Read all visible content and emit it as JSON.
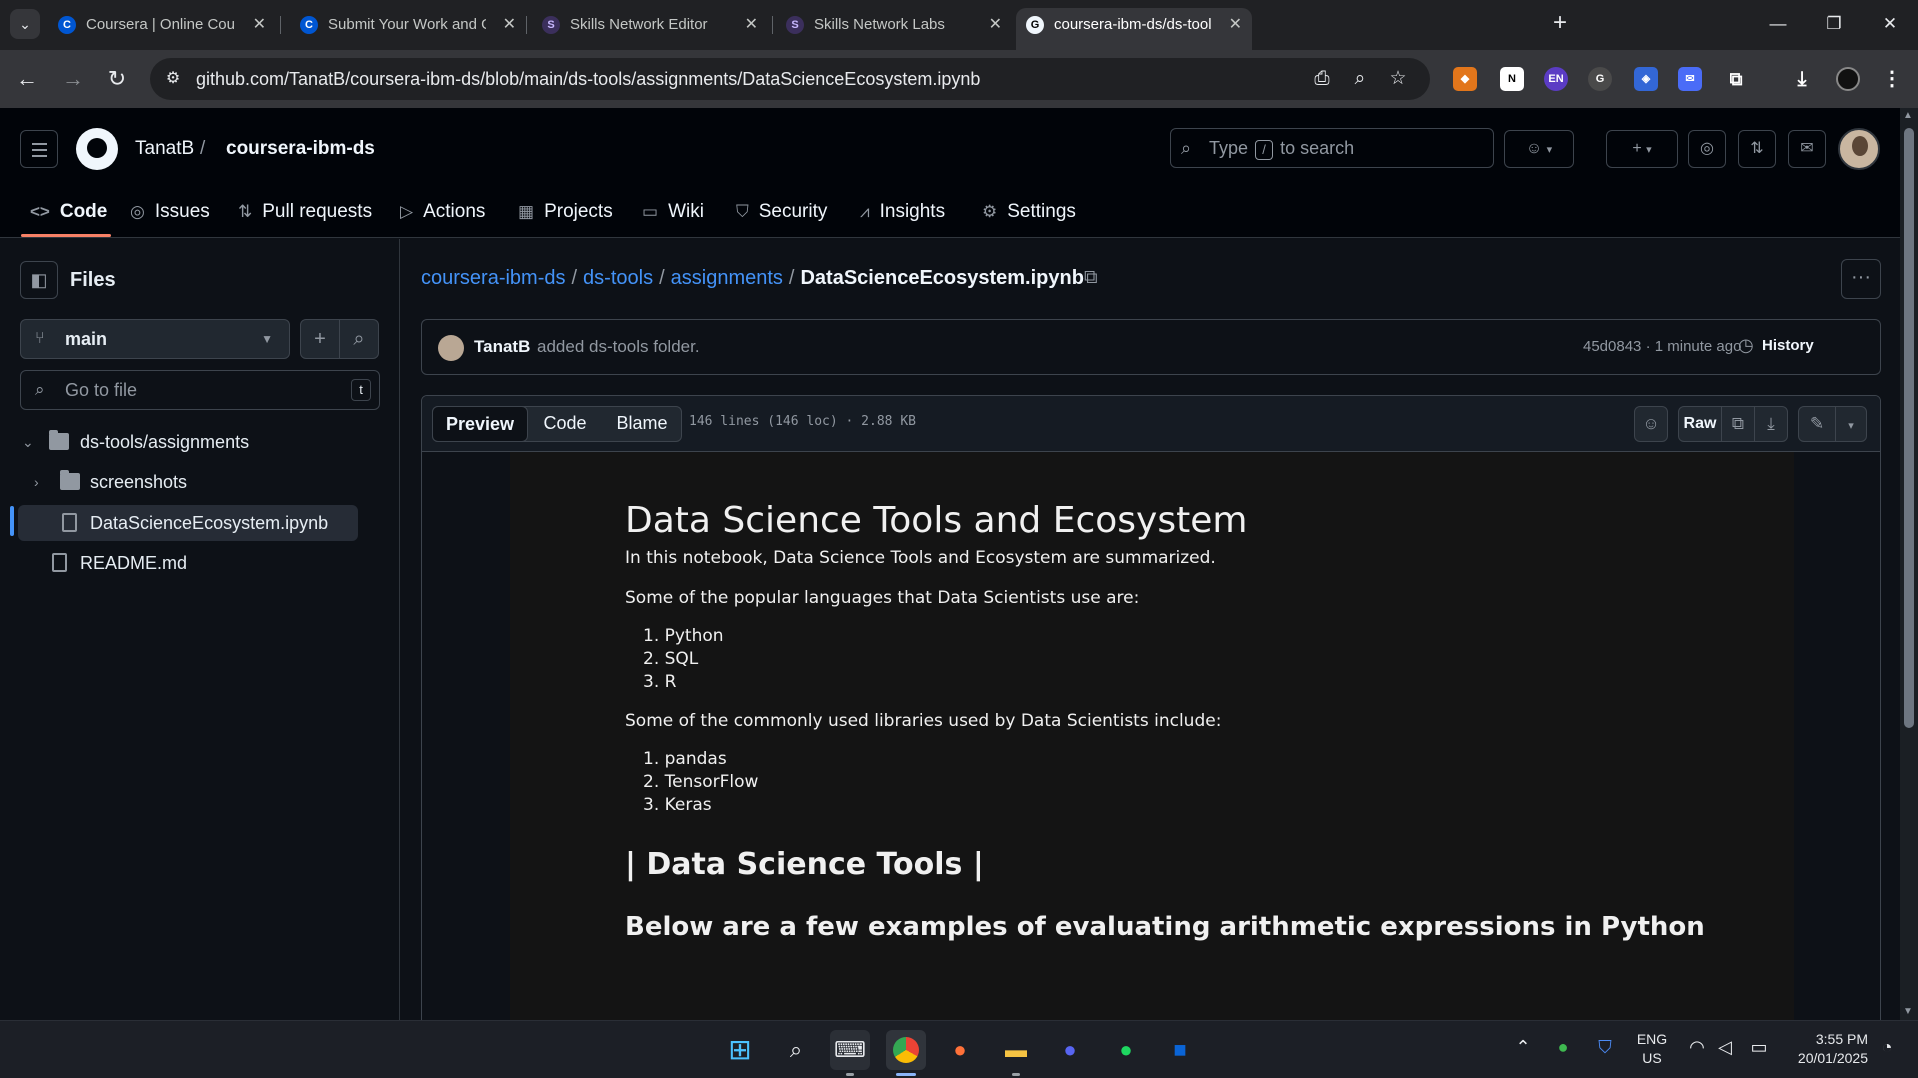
{
  "browser": {
    "tabs": [
      {
        "label": "Coursera | Online Courses From",
        "favicon": "C"
      },
      {
        "label": "Submit Your Work and Grade Yo",
        "favicon": "C"
      },
      {
        "label": "Skills Network Editor",
        "favicon": "S"
      },
      {
        "label": "Skills Network Labs",
        "favicon": "S"
      },
      {
        "label": "coursera-ibm-ds/ds-tools/assig",
        "favicon": "G",
        "active": true
      }
    ],
    "url": "github.com/TanatB/coursera-ibm-ds/blob/main/ds-tools/assignments/DataScienceEcosystem.ipynb",
    "extensions": [
      "fox-icon",
      "notion-icon",
      "EN",
      "grammarly-icon",
      "shield-icon",
      "translate-icon",
      "puzzle-icon"
    ]
  },
  "header": {
    "owner": "TanatB",
    "slash": "/",
    "repo": "coursera-ibm-ds",
    "search_prefix": "Type",
    "search_key": "/",
    "search_suffix": "to search",
    "plus": "+"
  },
  "repo_nav": [
    {
      "label": "Code",
      "icon": "code-icon",
      "active": true
    },
    {
      "label": "Issues",
      "icon": "issue-icon"
    },
    {
      "label": "Pull requests",
      "icon": "pull-request-icon"
    },
    {
      "label": "Actions",
      "icon": "play-icon"
    },
    {
      "label": "Projects",
      "icon": "table-icon"
    },
    {
      "label": "Wiki",
      "icon": "book-icon"
    },
    {
      "label": "Security",
      "icon": "shield-icon"
    },
    {
      "label": "Insights",
      "icon": "graph-icon"
    },
    {
      "label": "Settings",
      "icon": "gear-icon"
    }
  ],
  "sidebar": {
    "title": "Files",
    "branch": "main",
    "goto_placeholder": "Go to file",
    "goto_key": "t",
    "tree": [
      {
        "label": "ds-tools/assignments",
        "type": "folder",
        "expanded": true
      },
      {
        "label": "screenshots",
        "type": "folder",
        "expanded": false
      },
      {
        "label": "DataScienceEcosystem.ipynb",
        "type": "file",
        "selected": true
      },
      {
        "label": "README.md",
        "type": "file"
      }
    ]
  },
  "breadcrumb": {
    "parts": [
      "coursera-ibm-ds",
      "ds-tools",
      "assignments"
    ],
    "sep": "/",
    "current": "DataScienceEcosystem.ipynb"
  },
  "commit": {
    "author": "TanatB",
    "message": "added ds-tools folder.",
    "hash_time": "45d0843 · 1 minute ago",
    "history": "History"
  },
  "file_view": {
    "tabs": [
      "Preview",
      "Code",
      "Blame"
    ],
    "active_tab": "Preview",
    "meta": "146 lines (146 loc) · 2.88 KB",
    "raw": "Raw"
  },
  "notebook": {
    "h1": "Data Science Tools and Ecosystem",
    "intro": "In this notebook, Data Science Tools and Ecosystem are summarized.",
    "languages_intro": "Some of the popular languages that Data Scientists use are:",
    "languages": [
      "1. Python",
      "2. SQL",
      "3. R"
    ],
    "libraries_intro": "Some of the commonly used libraries used by Data Scientists include:",
    "libraries": [
      "1. pandas",
      "2. TensorFlow",
      "3. Keras"
    ],
    "h2": "| Data Science Tools |",
    "h3_partial": "Below are a few examples of evaluating arithmetic expressions in Python"
  },
  "taskbar": {
    "lang_top": "ENG",
    "lang_bottom": "US",
    "time": "3:55 PM",
    "date": "20/01/2025"
  },
  "colors": {
    "accent": "#4493f8",
    "underline": "#f78166",
    "bg": "#0d1117"
  }
}
